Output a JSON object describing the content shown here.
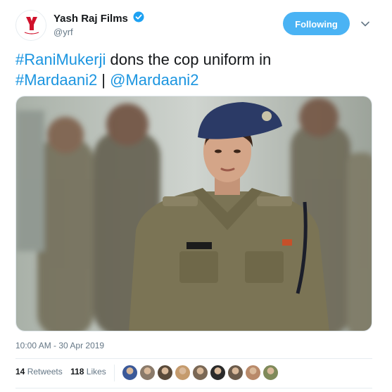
{
  "account": {
    "name": "Yash Raj Films",
    "handle": "@yrf",
    "logo_text": "Yash Raj Films"
  },
  "follow_button": {
    "label": "Following"
  },
  "tweet": {
    "segments": [
      {
        "text": "#RaniMukerji",
        "link": true
      },
      {
        "text": " dons the cop uniform in ",
        "link": false
      },
      {
        "text": "#Mardaani2",
        "link": true
      },
      {
        "text": " | ",
        "link": false
      },
      {
        "text": "@Mardaani2",
        "link": true
      }
    ]
  },
  "media": {
    "description_icon": "photo"
  },
  "timestamp": "10:00 AM - 30 Apr 2019",
  "stats": {
    "retweets_count": "14",
    "retweets_label": "Retweets",
    "likes_count": "118",
    "likes_label": "Likes"
  },
  "likers": [
    {
      "name": "liker-1",
      "color": "#3b5998"
    },
    {
      "name": "liker-2",
      "color": "#8a7a6a"
    },
    {
      "name": "liker-3",
      "color": "#5a4a3a"
    },
    {
      "name": "liker-4",
      "color": "#c59b6d"
    },
    {
      "name": "liker-5",
      "color": "#7a6855"
    },
    {
      "name": "liker-6",
      "color": "#2a2a2a"
    },
    {
      "name": "liker-7",
      "color": "#6b5b4b"
    },
    {
      "name": "liker-8",
      "color": "#b98a6a"
    },
    {
      "name": "liker-9",
      "color": "#7f8a5a"
    }
  ],
  "colors": {
    "link": "#1b95e0",
    "follow_bg": "#4ab3f4",
    "muted": "#657786",
    "verified": "#1da1f2",
    "brand_red": "#d0112b"
  }
}
